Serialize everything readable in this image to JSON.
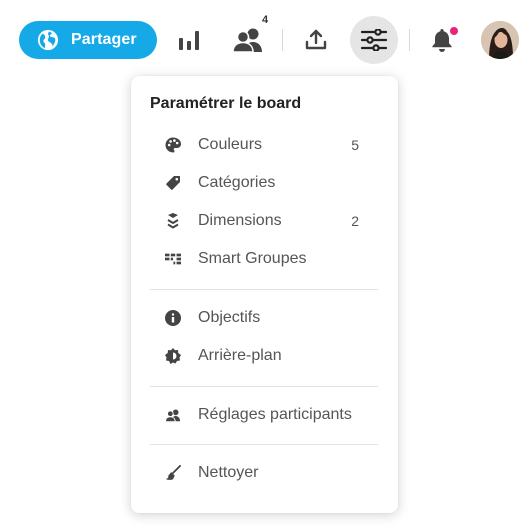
{
  "toolbar": {
    "share_label": "Partager",
    "participants_badge": "4",
    "notifications_unread": true
  },
  "settings_menu": {
    "title": "Paramétrer le board",
    "items": [
      {
        "label": "Couleurs",
        "icon": "palette-icon",
        "count": "5"
      },
      {
        "label": "Catégories",
        "icon": "tag-icon",
        "count": ""
      },
      {
        "label": "Dimensions",
        "icon": "layers-icon",
        "count": "2"
      },
      {
        "label": "Smart Groupes",
        "icon": "grid-icon",
        "count": ""
      },
      {
        "label": "Objectifs",
        "icon": "info-icon",
        "count": ""
      },
      {
        "label": "Arrière-plan",
        "icon": "background-icon",
        "count": ""
      },
      {
        "label": "Réglages participants",
        "icon": "users-icon",
        "count": ""
      },
      {
        "label": "Nettoyer",
        "icon": "broom-icon",
        "count": ""
      }
    ]
  },
  "colors": {
    "accent": "#15aae7",
    "icon": "#444444",
    "notification": "#e8247a",
    "active_bg": "#e5e5e5"
  }
}
